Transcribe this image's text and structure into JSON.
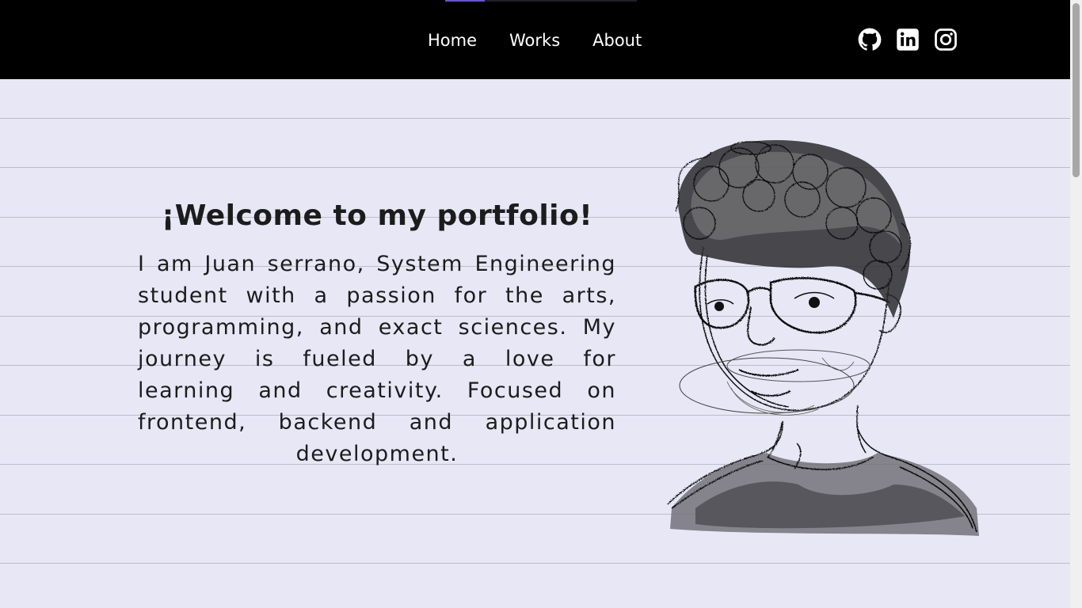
{
  "nav": {
    "items": [
      {
        "label": "Home"
      },
      {
        "label": "Works"
      },
      {
        "label": "About"
      }
    ]
  },
  "socials": [
    {
      "icon": "github-icon"
    },
    {
      "icon": "linkedin-icon"
    },
    {
      "icon": "instagram-icon"
    }
  ],
  "hero": {
    "title": "¡Welcome to my portfolio!",
    "description": "I am Juan serrano, System Engineering student with a passion for the arts, programming, and exact sciences. My journey is fueled by a love for learning and creativity. Focused on frontend, backend and application development."
  },
  "colors": {
    "header_bg": "#000000",
    "page_bg": "#e8e7f6",
    "accent": "#6a55c8",
    "text": "#1c1c1c"
  }
}
